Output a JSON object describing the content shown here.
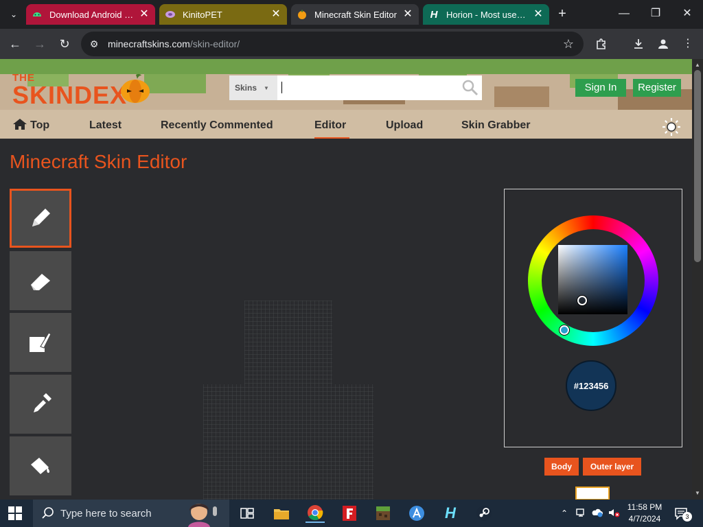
{
  "browser": {
    "tabs": [
      {
        "title": "Download Android Stu",
        "active": false
      },
      {
        "title": "KinitoPET",
        "active": false
      },
      {
        "title": "Minecraft Skin Editor",
        "active": true
      },
      {
        "title": "Horion - Most used M",
        "active": false
      }
    ],
    "url_host": "minecraftskins.com",
    "url_path": "/skin-editor/"
  },
  "site": {
    "logo_the": "THE",
    "logo_main": "SKINDEX",
    "search_scope": "Skins",
    "search_value": "",
    "sign_in": "Sign In",
    "register": "Register",
    "nav": {
      "top": "Top",
      "latest": "Latest",
      "recently_commented": "Recently Commented",
      "editor": "Editor",
      "upload": "Upload",
      "skin_grabber": "Skin Grabber"
    }
  },
  "editor": {
    "title": "Minecraft Skin Editor",
    "tools": [
      "pencil",
      "eraser",
      "paintbrush",
      "eyedropper",
      "paint-bucket"
    ],
    "active_tool": "pencil",
    "color_hex": "#123456",
    "layer_buttons": {
      "body": "Body",
      "outer_layer": "Outer layer"
    }
  },
  "taskbar": {
    "search_placeholder": "Type here to search",
    "time": "11:58 PM",
    "date": "4/7/2024",
    "notification_count": "3"
  },
  "colors": {
    "accent": "#e8541e",
    "green_button": "#2e9e4e",
    "selected_color": "#123456"
  }
}
